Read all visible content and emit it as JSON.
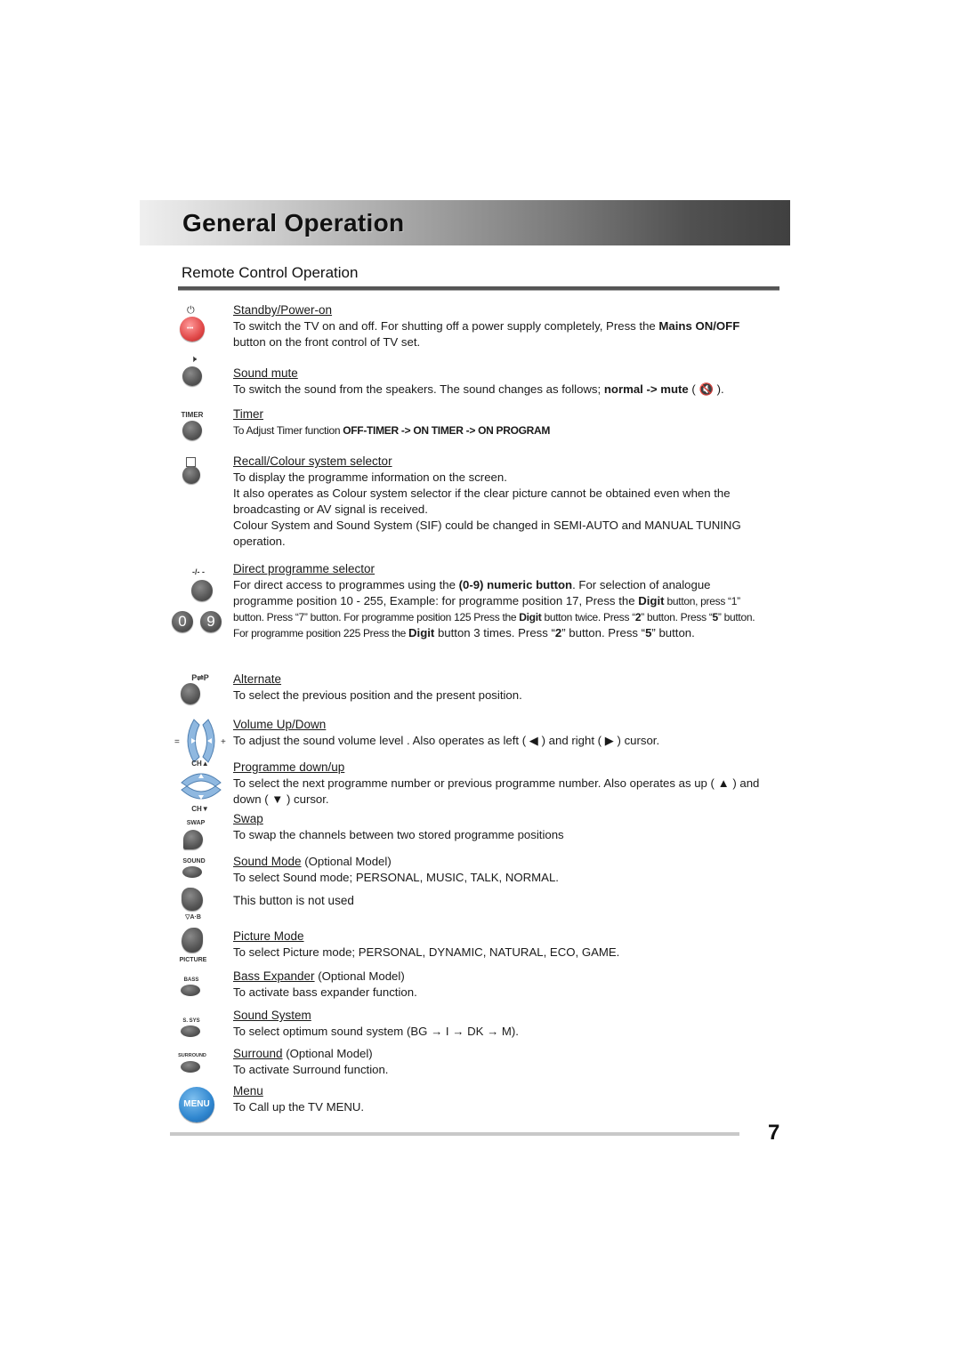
{
  "header": {
    "title": "General Operation"
  },
  "section": {
    "title": "Remote Control Operation"
  },
  "icons": {
    "power_label": "⏻",
    "timer_label": "TIMER",
    "direct_label": "-/- -",
    "zero": "0",
    "nine": "9",
    "alternate_label": "P⇌P",
    "ch_up_label": "CH▲",
    "ch_down_label": "CH▼",
    "swap_label": "SWAP",
    "sound_label": "SOUND",
    "ab_label": "▽A·B",
    "picture_label": "PICTURE",
    "bass_label": "BASS",
    "ssys_label": "S. SYS",
    "surround_label": "SURROUND",
    "menu_label": "MENU"
  },
  "items": [
    {
      "heading": "Standby/Power-on",
      "text1": "To switch the TV on and off. For shutting off a power supply completely, Press the ",
      "bold1": "Mains ON/OFF",
      "text2": " button on the front control of TV set."
    },
    {
      "heading": "Sound mute",
      "text1": "To switch the sound from the speakers. The sound changes as follows; ",
      "bold1": "normal -> mute",
      "text2": " ( 🔇 )."
    },
    {
      "heading": "Timer",
      "text1": "To Adjust Timer function  ",
      "bold1": "OFF-TIMER -> ON TIMER -> ON PROGRAM"
    },
    {
      "heading": "Recall/Colour system selector",
      "lines": [
        "To display the programme information on the screen.",
        "It also operates as Colour system selector if the clear picture cannot be obtained even when the broadcasting or AV signal is received.",
        "Colour System and Sound System (SIF) could be changed in SEMI-AUTO and MANUAL TUNING operation."
      ]
    },
    {
      "heading": "Direct programme selector",
      "p1": "For direct access to programmes using the ",
      "b1": "(0-9) numeric button",
      "p2": ". For selection of analogue programme position 10 - 255, Example: for programme position  17, Press the ",
      "b2": "Digit",
      "p3": " button, press “1” button. Press “7”  button. For programme position 125 Press the ",
      "b3": "Digit",
      "p4": " button twice. Press “",
      "b4": "2",
      "p5": "” button. Press “",
      "b5": "5",
      "p6": "” button. For programme position 225 Press the ",
      "b6": "Digit",
      "p7": "  button 3 times. Press “",
      "b7": "2",
      "p8": "” button. Press “",
      "b8": "5",
      "p9": "” button."
    },
    {
      "heading": "Alternate",
      "text1": "To select the previous position and the present position."
    },
    {
      "heading": "Volume Up/Down",
      "text1": "To adjust the sound volume level . Also operates as left  ( ◀ ) and right ( ▶ ) cursor."
    },
    {
      "heading": "Programme down/up",
      "text1": "To select the next programme number or previous programme number. Also operates as up ( ▲ ) and down ( ▼ ) cursor."
    },
    {
      "heading": "Swap",
      "text1": "To swap the channels between two stored programme positions"
    },
    {
      "heading": "Sound Mode",
      "optional": " (Optional Model)",
      "text1": "To select Sound  mode; PERSONAL, MUSIC, TALK, NORMAL."
    },
    {
      "heading_plain": "This button is not used"
    },
    {
      "heading": "Picture Mode",
      "text1": "To select Picture  mode; PERSONAL, DYNAMIC, NATURAL, ECO, GAME."
    },
    {
      "heading": "Bass Expander",
      "optional": " (Optional Model)",
      "text1": "To activate bass expander function."
    },
    {
      "heading": "Sound System",
      "text1": "To select optimum sound system (BG → I → DK → M)."
    },
    {
      "heading": "Surround",
      "optional": " (Optional Model)",
      "text1": "To activate Surround function."
    },
    {
      "heading": "Menu",
      "text1": "To Call up the TV MENU."
    }
  ],
  "footer": {
    "page_number": "7"
  }
}
